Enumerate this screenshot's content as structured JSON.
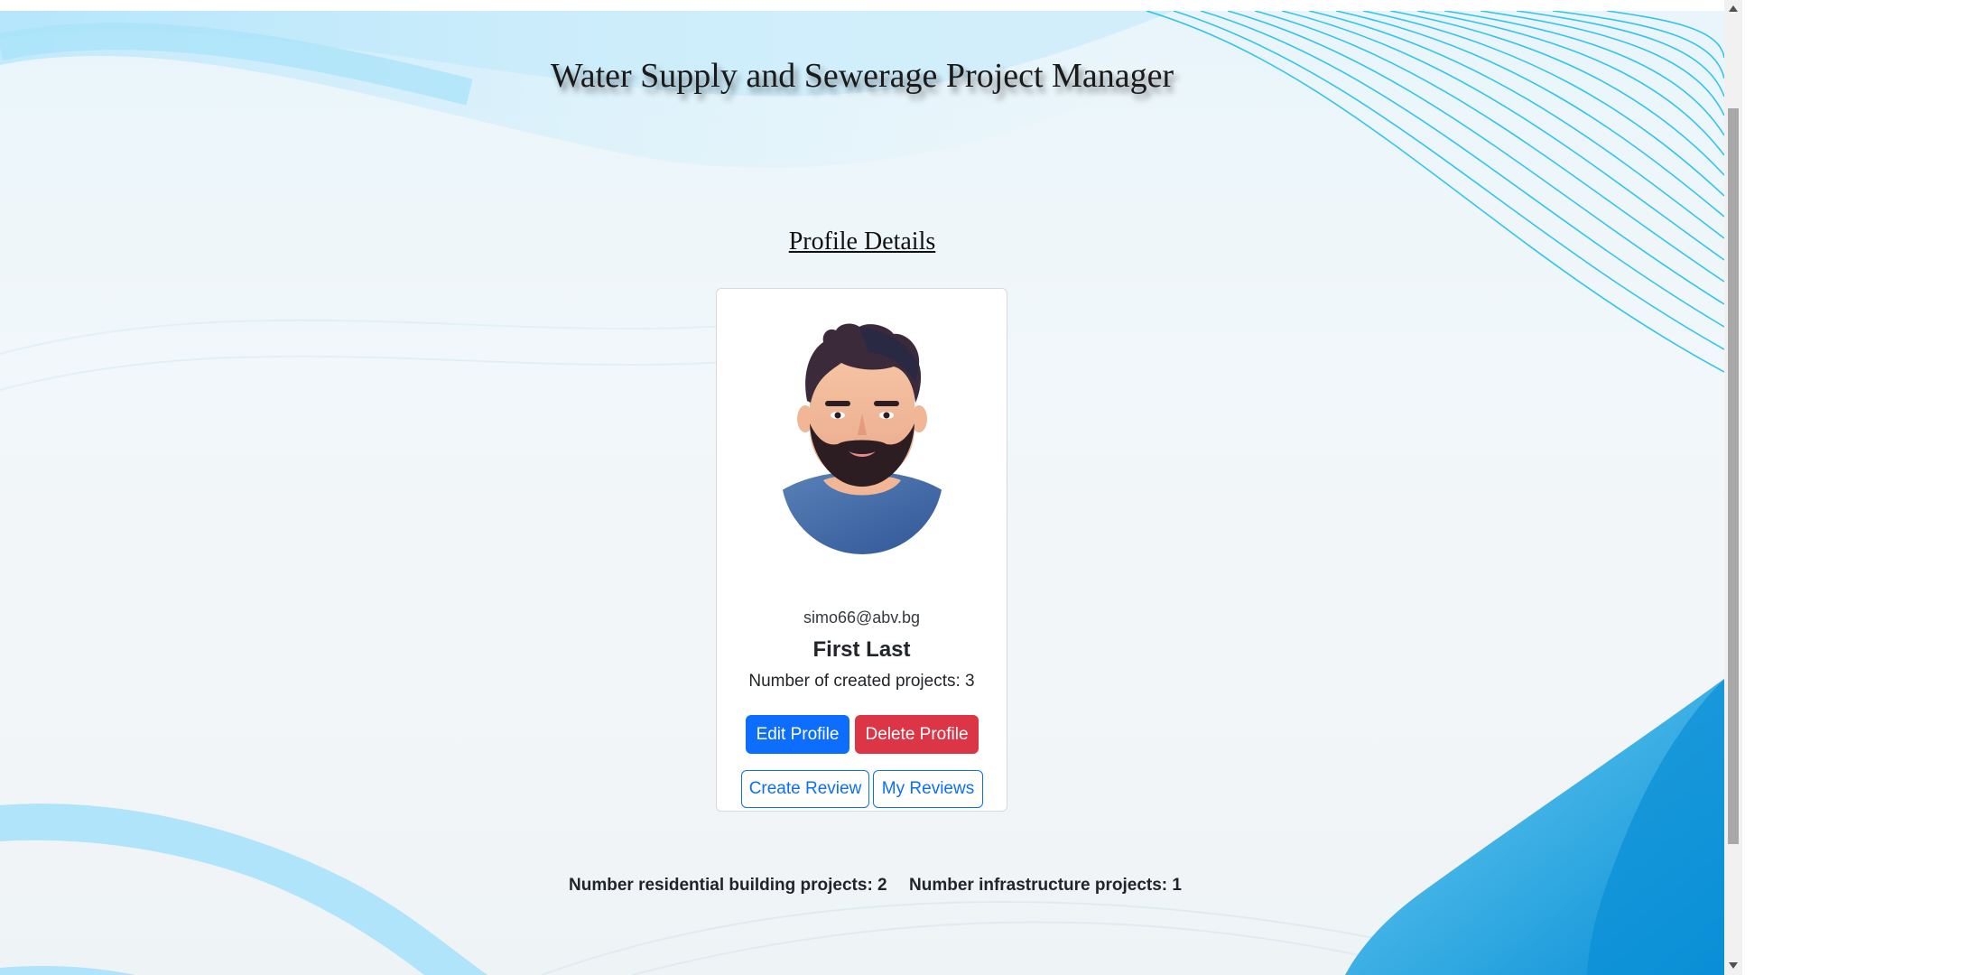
{
  "header": {
    "title": "Water Supply and Sewerage Project Manager"
  },
  "main": {
    "heading": "Profile Details"
  },
  "profile": {
    "email": "simo66@abv.bg",
    "name": "First Last",
    "created_projects": "Number of created projects: 3",
    "edit_label": "Edit Profile",
    "delete_label": "Delete Profile",
    "create_review_label": "Create Review",
    "my_reviews_label": "My Reviews"
  },
  "stats": {
    "residential": "Number residential building projects: 2",
    "infrastructure": "Number infrastructure projects: 1"
  },
  "colors": {
    "primary": "#0d6efd",
    "danger": "#dc3545",
    "wave_line": "#1cc4ea",
    "wave_fill": "#0a8fd6"
  },
  "icons": {
    "avatar": "bearded-man-avatar",
    "scroll_up": "arrow-up-icon",
    "scroll_down": "arrow-down-icon"
  }
}
